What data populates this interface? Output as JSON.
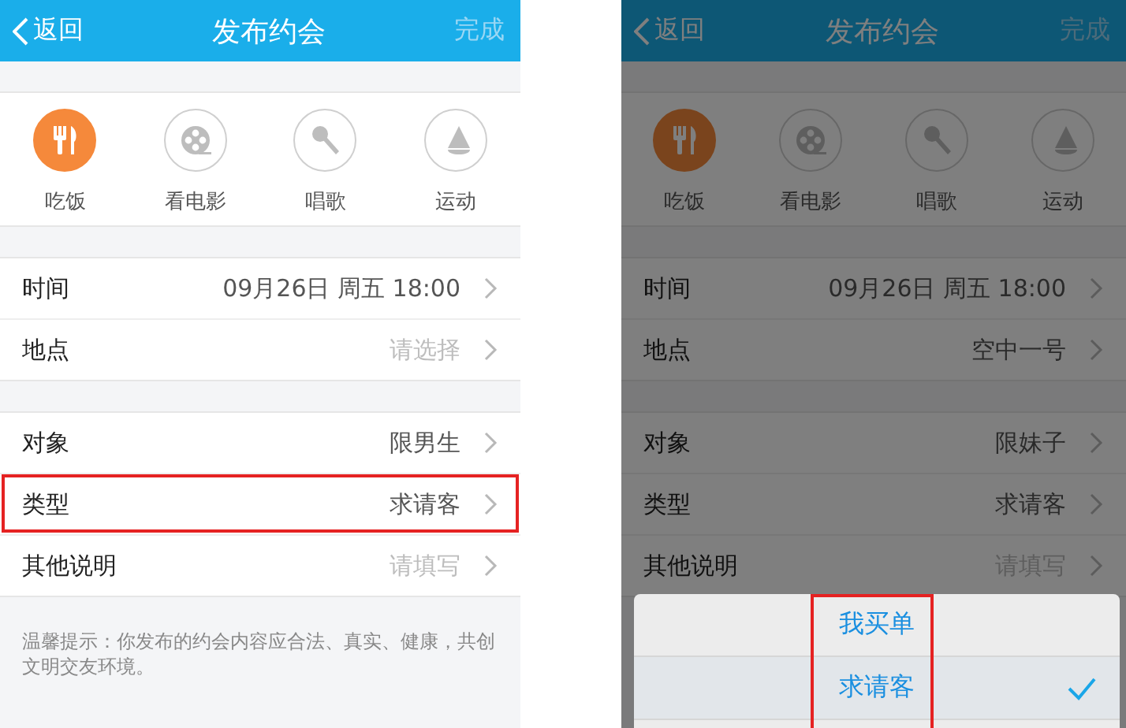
{
  "screens": [
    {
      "header": {
        "back": "返回",
        "title": "发布约会",
        "done": "完成"
      },
      "categories": [
        {
          "kind": "food",
          "label": "吃饭",
          "selected": true
        },
        {
          "kind": "movie",
          "label": "看电影",
          "selected": false
        },
        {
          "kind": "sing",
          "label": "唱歌",
          "selected": false
        },
        {
          "kind": "sport",
          "label": "运动",
          "selected": false
        }
      ],
      "sections": [
        [
          {
            "label": "时间",
            "value": "09月26日 周五 18:00",
            "highlighted": false
          },
          {
            "label": "地点",
            "placeholder": "请选择",
            "highlighted": false
          }
        ],
        [
          {
            "label": "对象",
            "value": "限男生",
            "highlighted": false
          },
          {
            "label": "类型",
            "value": "求请客",
            "highlighted": true
          },
          {
            "label": "其他说明",
            "placeholder": "请填写",
            "highlighted": false
          }
        ]
      ],
      "note": "温馨提示：你发布的约会内容应合法、真实、健康，共创文明交友环境。"
    },
    {
      "header": {
        "back": "返回",
        "title": "发布约会",
        "done": "完成"
      },
      "categories": [
        {
          "kind": "food",
          "label": "吃饭",
          "selected": true
        },
        {
          "kind": "movie",
          "label": "看电影",
          "selected": false
        },
        {
          "kind": "sing",
          "label": "唱歌",
          "selected": false
        },
        {
          "kind": "sport",
          "label": "运动",
          "selected": false
        }
      ],
      "sections": [
        [
          {
            "label": "时间",
            "value": "09月26日 周五 18:00",
            "highlighted": false
          },
          {
            "label": "地点",
            "value": "空中一号",
            "highlighted": false
          }
        ],
        [
          {
            "label": "对象",
            "value": "限妹子",
            "highlighted": false
          },
          {
            "label": "类型",
            "value": "求请客",
            "highlighted": false
          },
          {
            "label": "其他说明",
            "placeholder": "请填写",
            "highlighted": false
          }
        ]
      ],
      "sheet": {
        "highlighted": true,
        "options": [
          {
            "label": "我买单",
            "selected": false
          },
          {
            "label": "求请客",
            "selected": true
          }
        ]
      }
    }
  ]
}
